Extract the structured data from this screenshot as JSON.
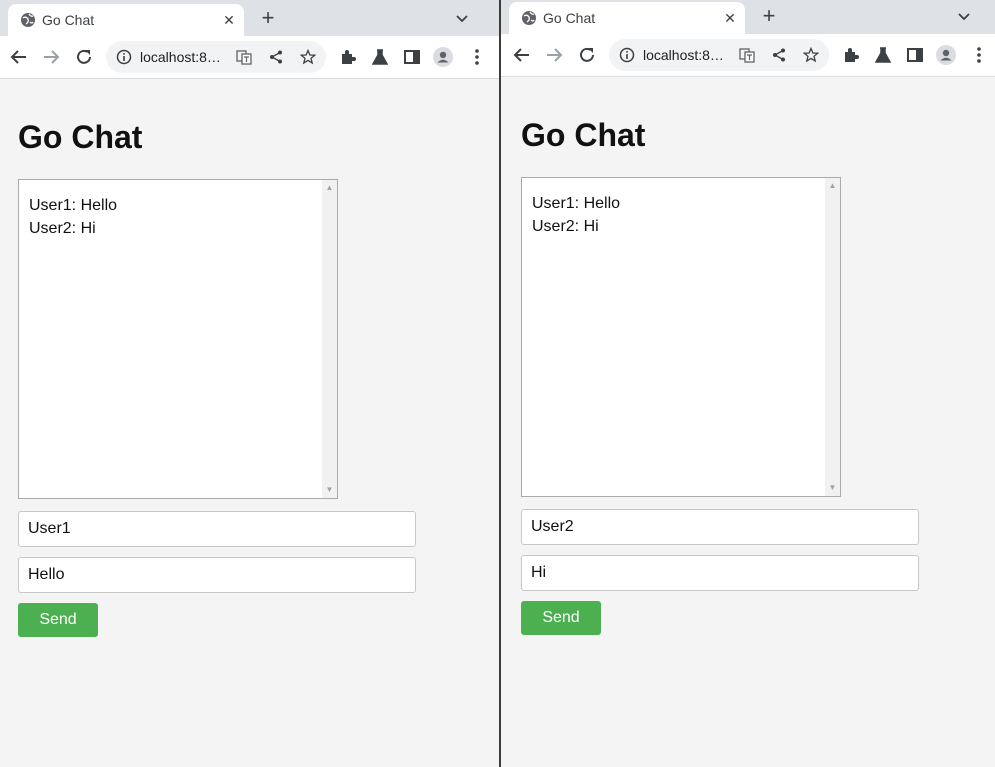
{
  "windows": [
    {
      "tab_title": "Go Chat",
      "url": "localhost:8…",
      "page_title": "Go Chat",
      "messages": [
        "User1: Hello",
        "User2: Hi"
      ],
      "username_value": "User1",
      "message_value": "Hello",
      "send_label": "Send"
    },
    {
      "tab_title": "Go Chat",
      "url": "localhost:8…",
      "page_title": "Go Chat",
      "messages": [
        "User1: Hello",
        "User2: Hi"
      ],
      "username_value": "User2",
      "message_value": "Hi",
      "send_label": "Send"
    }
  ],
  "icons": {
    "tab": [
      "globe-icon",
      "close-icon",
      "new-tab-icon",
      "tab-search-icon"
    ],
    "toolbar": [
      "back-icon",
      "forward-icon",
      "reload-icon",
      "info-icon",
      "translate-icon",
      "share-icon",
      "star-icon",
      "extensions-icon",
      "labs-icon",
      "side-panel-icon",
      "profile-icon",
      "menu-icon"
    ]
  },
  "colors": {
    "send_button": "#4caf50",
    "page_background": "#f4f4f4",
    "tab_strip": "#dee1e6"
  }
}
